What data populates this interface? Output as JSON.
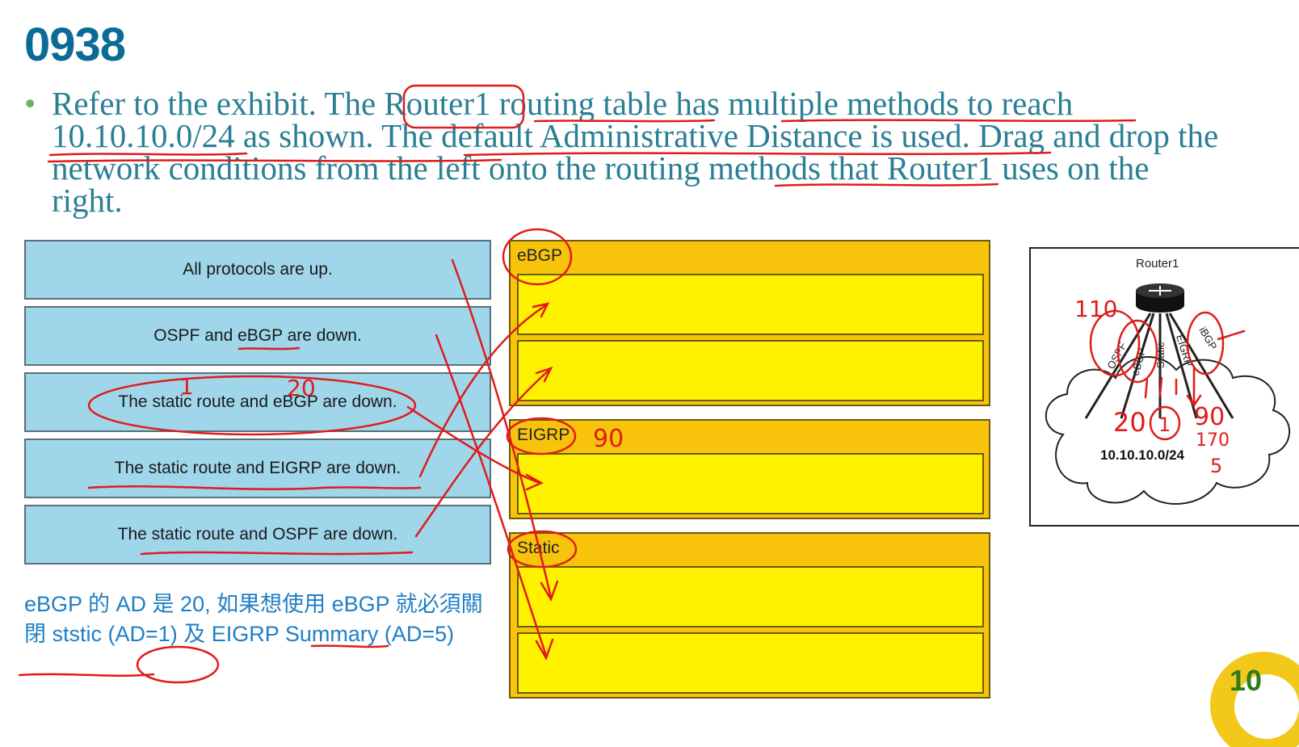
{
  "title": "0938",
  "question": {
    "bullet": "•",
    "text": "Refer to the exhibit. The Router1 routing table has multiple methods to reach 10.10.10.0/24 as shown. The default Administrative Distance is used. Drag and drop the network conditions from the left onto the routing methods that Router1 uses on the right."
  },
  "conditions": [
    "All protocols are up.",
    "OSPF and eBGP are down.",
    "The static route and eBGP are down.",
    "The static route and EIGRP are down.",
    "The static route and OSPF are down."
  ],
  "targets": [
    {
      "label": "eBGP"
    },
    {
      "label": "EIGRP"
    },
    {
      "label": "Static"
    }
  ],
  "exhibit": {
    "router": "Router1",
    "protocols": [
      "OSPF",
      "eBGP",
      "Static",
      "EIGRP",
      "iBGP"
    ],
    "network": "10.10.10.0/24"
  },
  "note": "eBGP 的 AD 是 20, 如果想使用 eBGP 就必須關閉 ststic (AD=1) 及 EIGRP Summary (AD=5)",
  "annotations": {
    "ad_static": "1",
    "ad_ebgp": "20",
    "ad_eigrp": "90",
    "ad_ospf": "110",
    "ad_ebgp_exhibit": "20",
    "ad_static_exhibit": "1",
    "ad_eigrp_exhibit": "90",
    "ad_external": "170",
    "ad_summary": "5"
  },
  "page_number": "10",
  "colors": {
    "title": "#0a6b96",
    "question": "#2a7f94",
    "source_box": "#9fd6ea",
    "target_group": "#f8c40b",
    "target_slot": "#fff200",
    "ink": "#e01b1b",
    "note": "#1f7fc4"
  }
}
